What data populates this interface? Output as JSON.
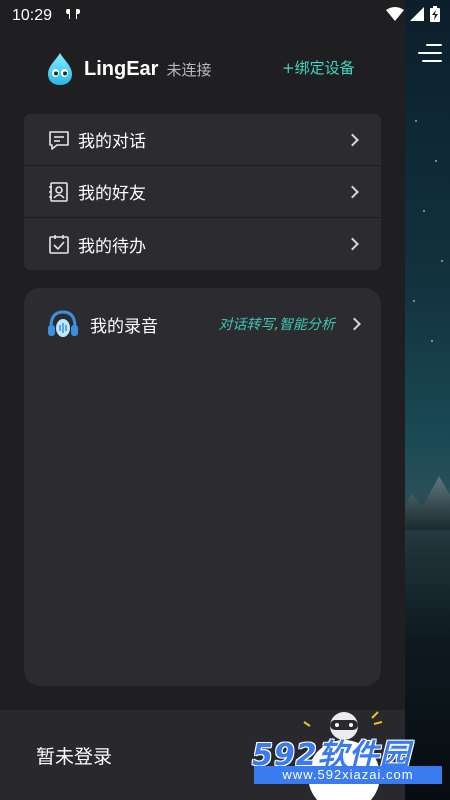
{
  "status_bar": {
    "time": "10:29",
    "left_icon": "earbuds-icon",
    "right_icons": [
      "wifi-icon",
      "signal-icon",
      "battery-charging-icon"
    ]
  },
  "header": {
    "app_name": "LingEar",
    "connection_status": "未连接",
    "bind_device": "+绑定设备",
    "logo_icon": "water-drop-face-icon"
  },
  "menu": {
    "items": [
      {
        "label": "我的对话",
        "icon": "chat-icon"
      },
      {
        "label": "我的好友",
        "icon": "contacts-icon"
      },
      {
        "label": "我的待办",
        "icon": "todo-icon"
      }
    ]
  },
  "recordings": {
    "label": "我的录音",
    "hint": "对话转写,智能分析",
    "icon": "headphones-icon"
  },
  "footer": {
    "login_status": "暂未登录",
    "avatar_icon": "robot-avatar-icon"
  },
  "watermark": {
    "title": "592软件园",
    "url": "www.592xiazai.com"
  },
  "colors": {
    "accent": "#3fd6c2",
    "drawer_bg": "#1f1f22",
    "card_bg": "#2b2b30",
    "footer_bg": "#29292d"
  }
}
